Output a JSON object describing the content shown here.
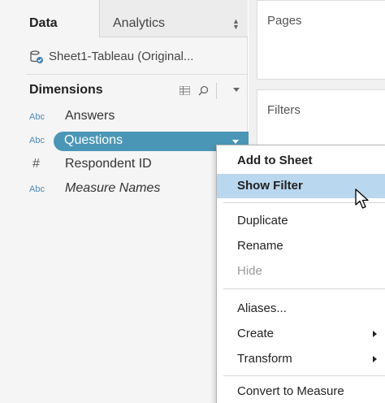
{
  "tabs": {
    "data_label": "Data",
    "analytics_label": "Analytics"
  },
  "datasource": {
    "name": "Sheet1-Tableau (Original..."
  },
  "dimensions": {
    "title": "Dimensions",
    "fields": [
      {
        "type": "Abc",
        "name": "Answers"
      },
      {
        "type": "Abc",
        "name": "Questions"
      },
      {
        "type": "#",
        "name": "Respondent ID"
      },
      {
        "type": "Abc",
        "name": "Measure Names"
      }
    ]
  },
  "shelves": {
    "pages_label": "Pages",
    "filters_label": "Filters"
  },
  "context_menu": {
    "items": [
      {
        "label": "Add to Sheet"
      },
      {
        "label": "Show Filter"
      },
      {
        "label": "Duplicate"
      },
      {
        "label": "Rename"
      },
      {
        "label": "Hide"
      },
      {
        "label": "Aliases..."
      },
      {
        "label": "Create"
      },
      {
        "label": "Transform"
      },
      {
        "label": "Convert to Measure"
      }
    ]
  },
  "colors": {
    "pill": "#4a96b6",
    "menu_hover": "#b9d7ee",
    "type_abc": "#4a8ab8"
  }
}
